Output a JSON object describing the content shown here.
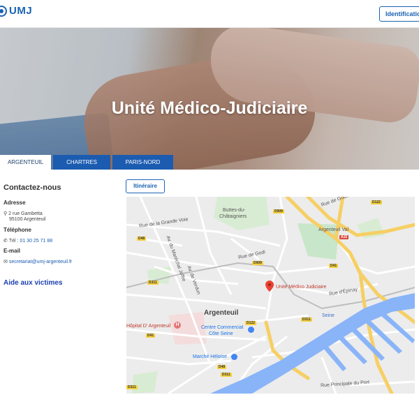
{
  "header": {
    "logo_text": "UMJ",
    "identification_label": "Identification"
  },
  "hero": {
    "title": "Unité Médico-Judiciaire"
  },
  "tabs": [
    {
      "label": "ARGENTEUIL",
      "active": true
    },
    {
      "label": "CHARTRES",
      "active": false
    },
    {
      "label": "PARIS-NORD",
      "active": false
    }
  ],
  "contact": {
    "title": "Contactez-nous",
    "address_label": "Adresse",
    "address_line1": "2 rue Gambetta",
    "address_line2": "95100 Argenteuil",
    "phone_label": "Téléphone",
    "phone_prefix": "Tél :",
    "phone_number": "01 30 25 71 88",
    "email_label": "E-mail",
    "email": "secretariat@umj-argenteuil.fr",
    "aide_link": "Aide aux victimes"
  },
  "map": {
    "itinerary_label": "Itinéraire",
    "marker_label": "Unité Médico Judiciaire",
    "city_label": "Argenteuil",
    "labels": {
      "buttes": "Buttes-du-",
      "chataigniers": "Châtaigniers",
      "hopital": "Hôpital D' Argenteuil",
      "centre_commercial": "Centre Commercial",
      "cote_seine": "Côte Seine",
      "marche": "Marché Héloïse",
      "rue_grande_voie": "Rue de la Grande Voie",
      "rue_gode": "Rue de Gode",
      "rue_epinay": "Rue d'Épinay",
      "rue_principale_port": "Rue Principale du Port",
      "seine": "Seine",
      "argenteuil_val": "Argenteuil Val",
      "rue_godi": "Rue de Godi",
      "marechal_joffre": "Av. du Maréchal Joffre",
      "av_verdun": "Av. de Verdun"
    },
    "roads": [
      "D909",
      "D48",
      "D311",
      "D41",
      "D122",
      "A15",
      "D909",
      "D311",
      "D41",
      "D48",
      "D122",
      "D311",
      "D311"
    ],
    "colors": {
      "water": "#8ab4f8",
      "park": "#c8e6c9",
      "major_road": "#f6cf65",
      "marker": "#ea4335"
    }
  },
  "colors": {
    "brand_blue": "#1b63b3",
    "tab_blue": "#1b5bb0"
  }
}
